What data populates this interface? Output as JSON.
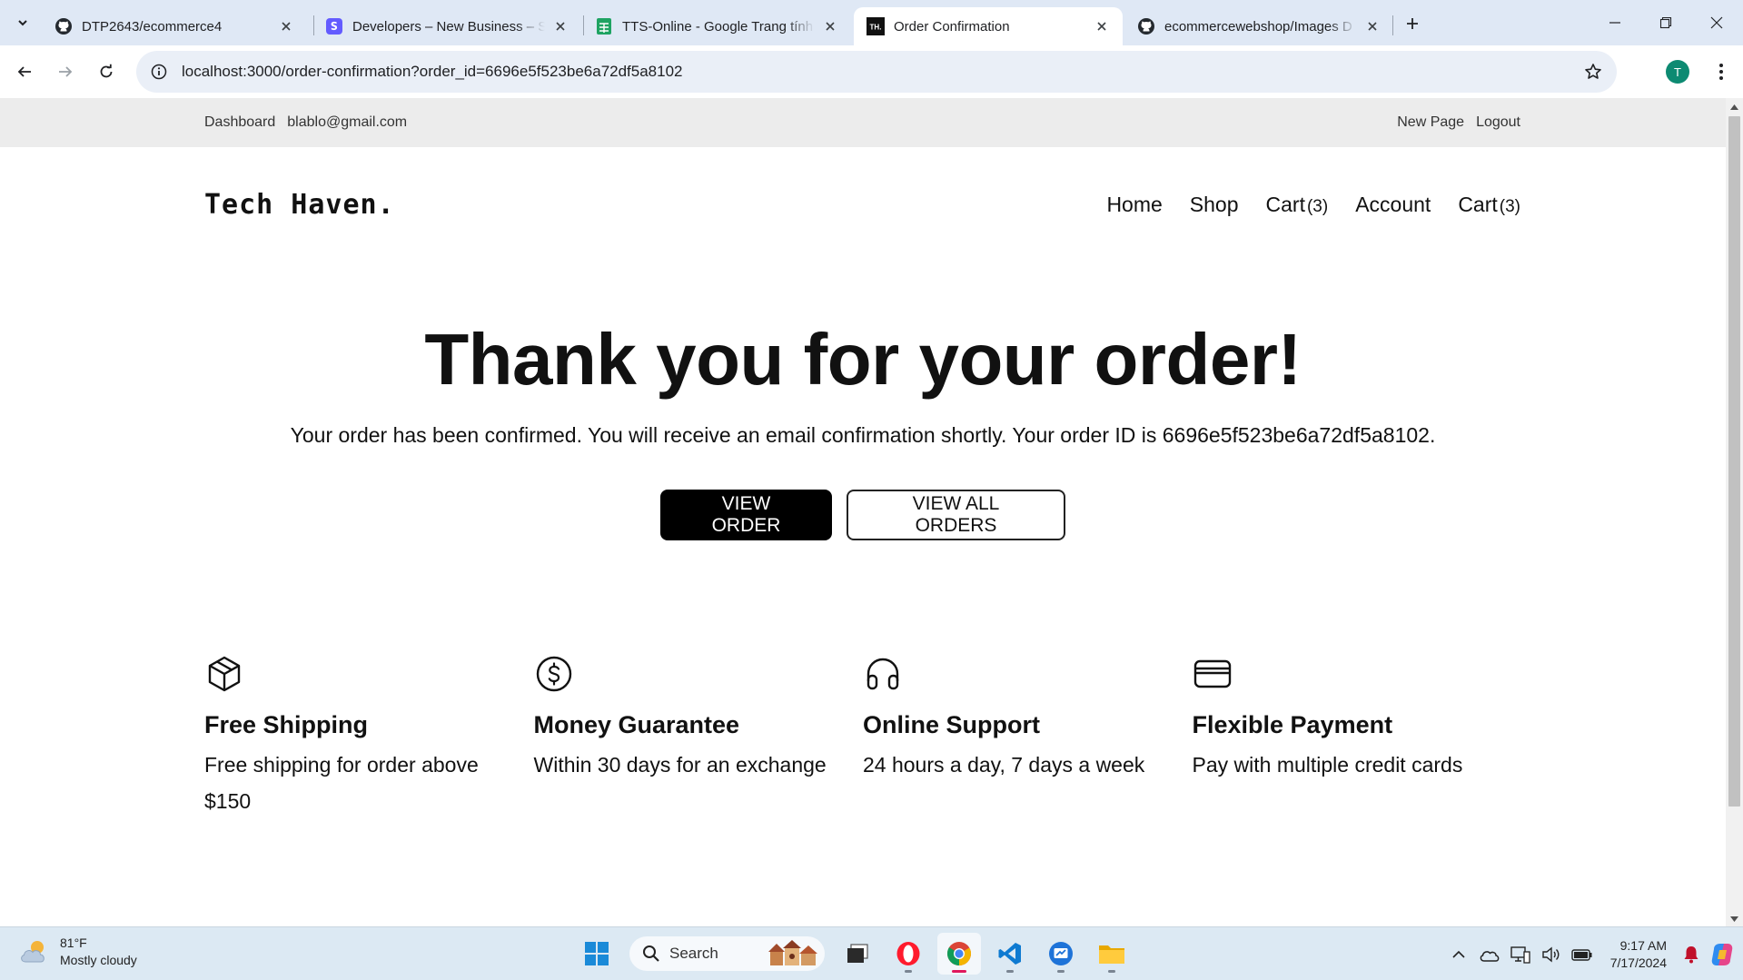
{
  "browser": {
    "tabs": [
      {
        "title": "DTP2643/ecommerce4",
        "icon": "github-icon"
      },
      {
        "title": "Developers – New Business – St",
        "icon": "stripe-icon"
      },
      {
        "title": "TTS-Online - Google Trang tính",
        "icon": "sheets-icon"
      },
      {
        "title": "Order Confirmation",
        "icon": "tech-haven-favicon",
        "active": true
      },
      {
        "title": "ecommercewebshop/Images D",
        "icon": "github-icon"
      }
    ],
    "url": "localhost:3000/order-confirmation?order_id=6696e5f523be6a72df5a8102",
    "profile_initial": "T"
  },
  "site": {
    "topbar": {
      "left": [
        "Dashboard",
        "blablo@gmail.com"
      ],
      "right": [
        "New Page",
        "Logout"
      ]
    },
    "logo": "Tech Haven.",
    "nav": {
      "home": "Home",
      "shop": "Shop",
      "cart_label": "Cart",
      "cart_count": "(3)",
      "account": "Account",
      "cart2_label": "Cart",
      "cart2_count": "(3)"
    }
  },
  "confirmation": {
    "title": "Thank you for your order!",
    "message": "Your order has been confirmed. You will receive an email confirmation shortly. Your order ID is 6696e5f523be6a72df5a8102.",
    "view_order": "VIEW ORDER",
    "view_all_orders": "VIEW ALL ORDERS"
  },
  "features": [
    {
      "icon": "box-icon",
      "title": "Free Shipping",
      "text": "Free shipping for order above $150"
    },
    {
      "icon": "dollar-circle-icon",
      "title": "Money Guarantee",
      "text": "Within 30 days for an exchange"
    },
    {
      "icon": "headphones-icon",
      "title": "Online Support",
      "text": "24 hours a day, 7 days a week"
    },
    {
      "icon": "credit-card-icon",
      "title": "Flexible Payment",
      "text": "Pay with multiple credit cards"
    }
  ],
  "taskbar": {
    "weather_temp": "81°F",
    "weather_desc": "Mostly cloudy",
    "search_placeholder": "Search",
    "time": "9:17 AM",
    "date": "7/17/2024"
  }
}
